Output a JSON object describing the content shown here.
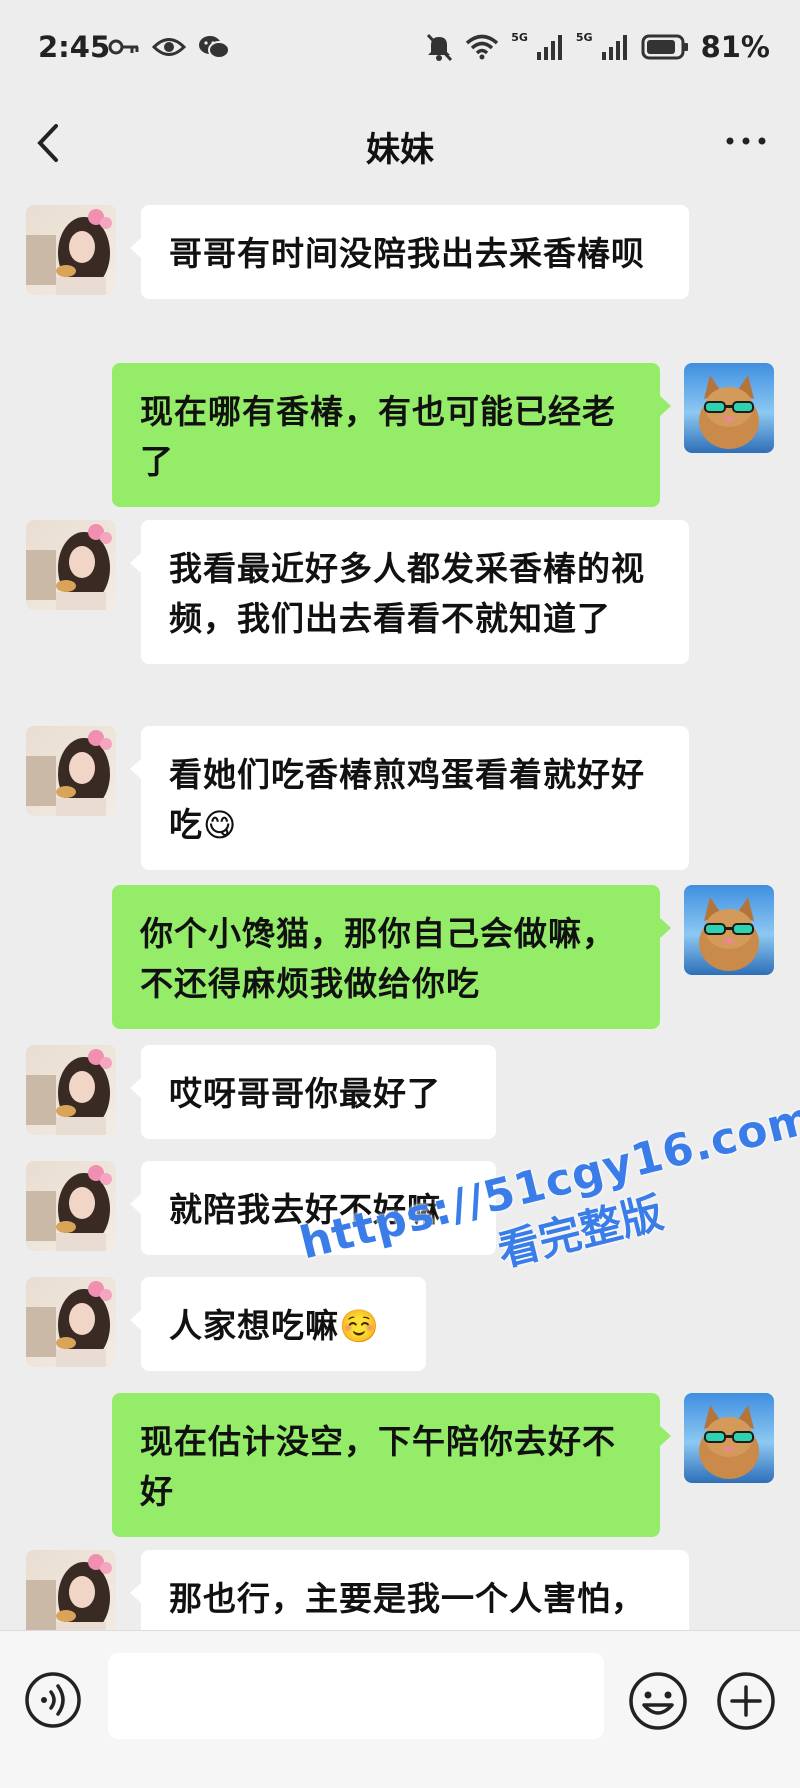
{
  "status_bar": {
    "time": "2:45",
    "battery": "81%",
    "network_1": "5G",
    "network_2": "5G"
  },
  "nav": {
    "title": "妹妹"
  },
  "messages": [
    {
      "from": "sister",
      "text": "哥哥有时间没陪我出去采香椿呗",
      "emoji": ""
    },
    {
      "from": "me",
      "text": "现在哪有香椿，有也可能已经老了",
      "emoji": ""
    },
    {
      "from": "sister",
      "text": "我看最近好多人都发采香椿的视频，我们出去看看不就知道了",
      "emoji": ""
    },
    {
      "from": "sister",
      "text": "看她们吃香椿煎鸡蛋看着就好好吃",
      "emoji": "😋"
    },
    {
      "from": "me",
      "text": "你个小馋猫，那你自己会做嘛，不还得麻烦我做给你吃",
      "emoji": ""
    },
    {
      "from": "sister",
      "text": "哎呀哥哥你最好了",
      "emoji": ""
    },
    {
      "from": "sister",
      "text": "就陪我去好不好嘛",
      "emoji": ""
    },
    {
      "from": "sister",
      "text": "人家想吃嘛",
      "emoji": "☺️"
    },
    {
      "from": "me",
      "text": "现在估计没空，下午陪你去好不好",
      "emoji": ""
    },
    {
      "from": "sister",
      "text": "那也行，主要是我一个人害怕，所以才要哥哥你陪我去",
      "emoji": ""
    }
  ],
  "watermark": {
    "url": "https://51cgy16.com",
    "caption": "看完整版"
  },
  "icons": {
    "back": "chevron-left-icon",
    "more": "more-dots-icon",
    "voice": "voice-icon",
    "emoji": "emoji-icon",
    "plus": "plus-icon"
  },
  "colors": {
    "background": "#ededed",
    "my_bubble": "#95ec69",
    "their_bubble": "#ffffff",
    "watermark": "#3a7de8"
  }
}
